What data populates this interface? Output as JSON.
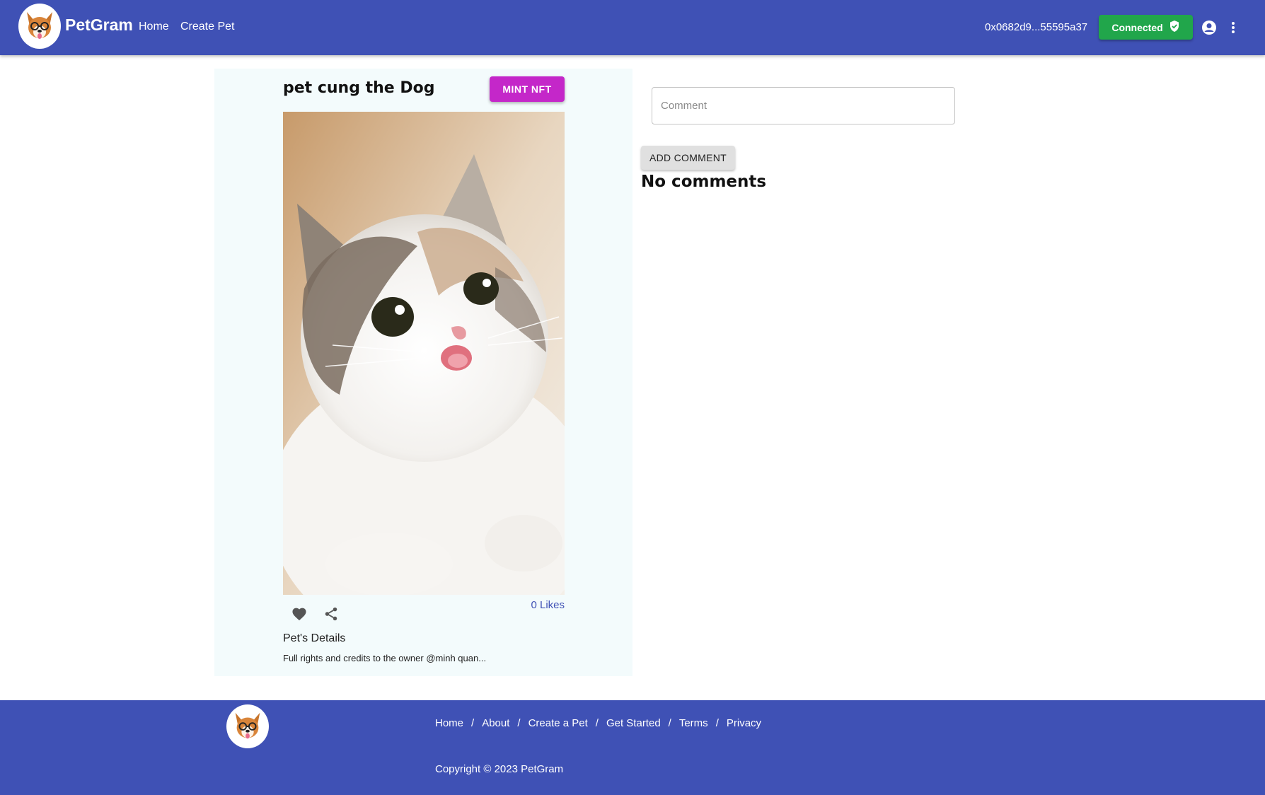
{
  "header": {
    "brand": "PetGram",
    "nav": [
      "Home",
      "Create Pet"
    ],
    "wallet_address": "0x0682d9...55595a37",
    "connected_label": "Connected",
    "icons": [
      "petgram-logo-icon",
      "shield-check-icon",
      "account-circle-icon",
      "more-vert-icon"
    ]
  },
  "pet": {
    "title": "pet cung the Dog",
    "mint_label": "MINT NFT",
    "likes": "0 Likes",
    "details_title": "Pet's Details",
    "details_text": "Full rights and credits to the owner @minh quan..."
  },
  "comments": {
    "placeholder": "Comment",
    "value": "",
    "add_label": "ADD COMMENT",
    "empty_text": "No comments"
  },
  "footer": {
    "links": [
      "Home",
      "About",
      "Create a Pet",
      "Get Started",
      "Terms",
      "Privacy"
    ],
    "separator": "/",
    "copyright": "Copyright © 2023 PetGram"
  },
  "colors": {
    "primary": "#3f51b5",
    "connected": "#21a64b",
    "mint": "#c427c9",
    "card_bg": "#f3fbfc"
  }
}
